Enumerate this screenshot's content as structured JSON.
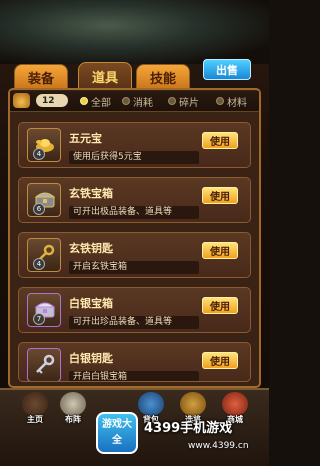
{
  "tabs": [
    {
      "label": "装备"
    },
    {
      "label": "道具"
    },
    {
      "label": "技能"
    }
  ],
  "sell_button": "出售",
  "item_count": "12",
  "filters": [
    {
      "label": "全部"
    },
    {
      "label": "消耗"
    },
    {
      "label": "碎片"
    },
    {
      "label": "材料"
    }
  ],
  "use_label": "使用",
  "items": [
    {
      "name": "五元宝",
      "desc": "使用后获得5元宝",
      "qty": "4",
      "icon": "gold-ingot-icon"
    },
    {
      "name": "玄铁宝箱",
      "desc": "可开出极品装备、道具等",
      "qty": "6",
      "icon": "iron-chest-icon"
    },
    {
      "name": "玄铁钥匙",
      "desc": "开启玄铁宝箱",
      "qty": "4",
      "icon": "iron-key-icon"
    },
    {
      "name": "白银宝箱",
      "desc": "可开出珍品装备、道具等",
      "qty": "7",
      "icon": "silver-chest-icon"
    },
    {
      "name": "白银钥匙",
      "desc": "开启白银宝箱",
      "qty": "",
      "icon": "silver-key-icon"
    }
  ],
  "nav": [
    {
      "label": "主页"
    },
    {
      "label": "布阵"
    },
    {
      "label": "背包"
    },
    {
      "label": "选将"
    },
    {
      "label": "商城"
    }
  ],
  "watermark": {
    "logo": "游戏大全",
    "title": "4399手机游戏",
    "url": "www.4399.cn"
  }
}
